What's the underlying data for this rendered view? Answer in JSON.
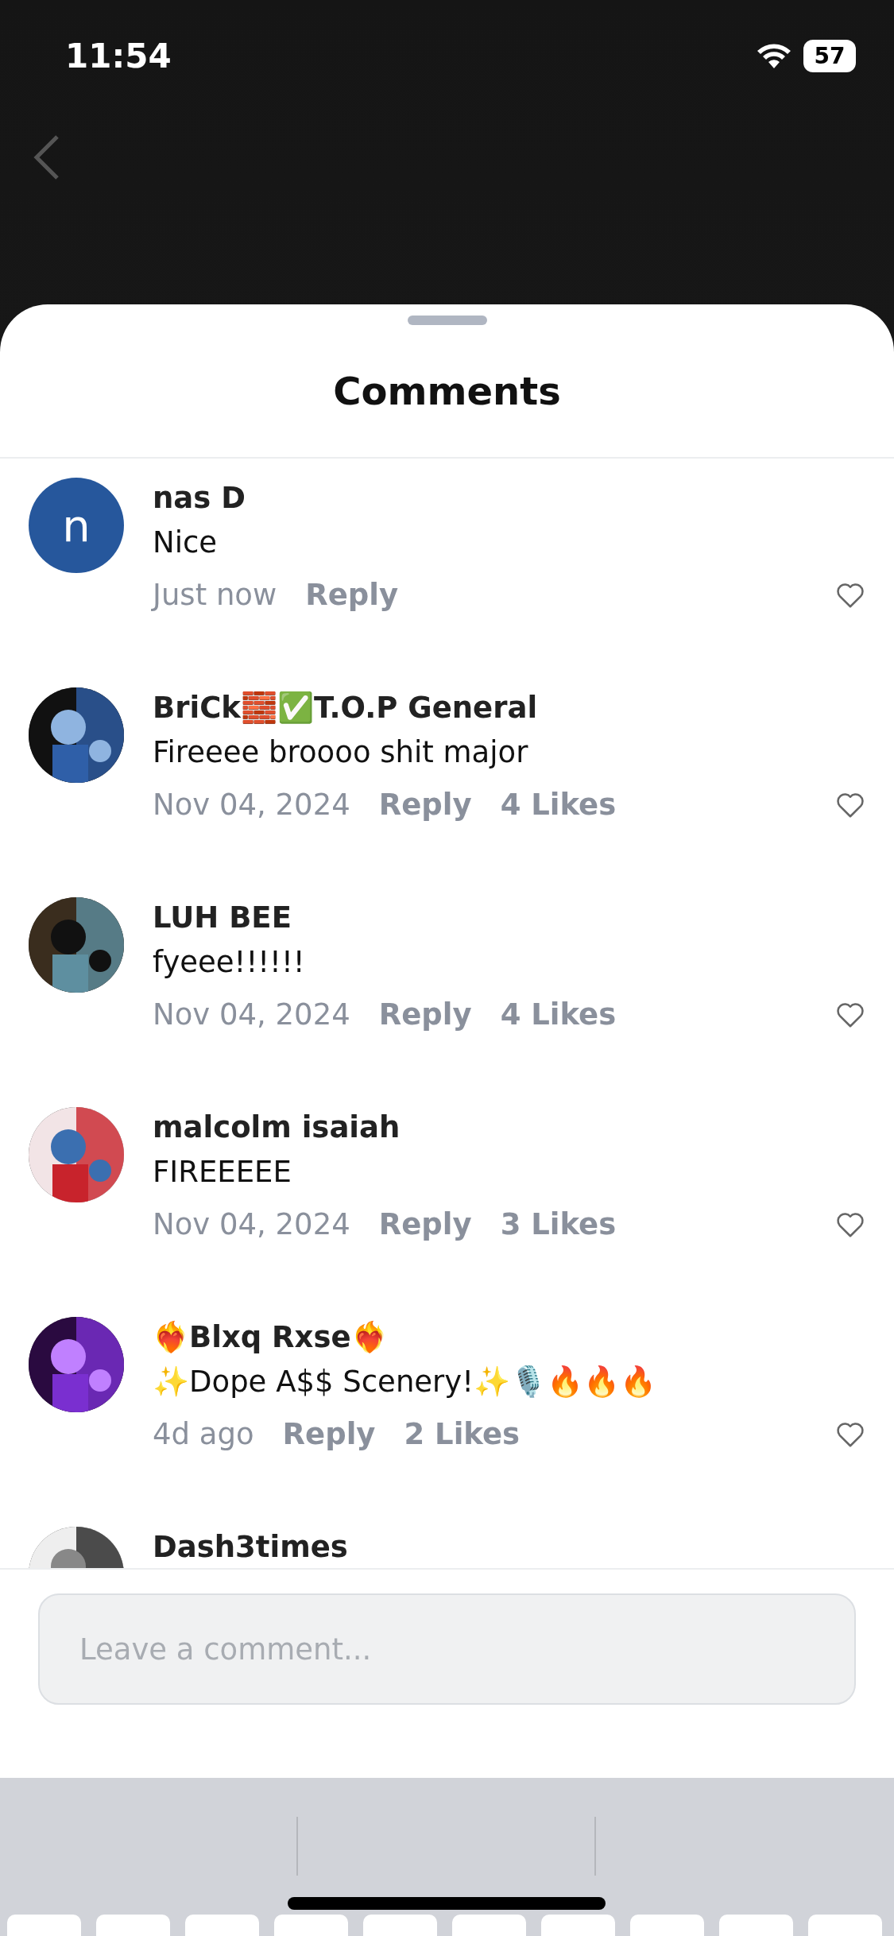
{
  "status_bar": {
    "time": "11:54",
    "battery": "57"
  },
  "sheet": {
    "title": "Comments"
  },
  "comments": [
    {
      "avatar": {
        "kind": "letter",
        "letter": "n",
        "color": "#26579c"
      },
      "name": "nas D",
      "text": "Nice",
      "time": "Just now",
      "reply": "Reply"
    },
    {
      "name": "BriCk🧱✅T.O.P General",
      "text": "Fireeee broooo shit major",
      "time": "Nov 04, 2024",
      "reply": "Reply",
      "likes": "4 Likes"
    },
    {
      "name": "LUH BEE",
      "text": "fyeee!!!!!!",
      "time": "Nov 04, 2024",
      "reply": "Reply",
      "likes": "4 Likes"
    },
    {
      "name": "malcolm isaiah",
      "text": "FIREEEEE",
      "time": "Nov 04, 2024",
      "reply": "Reply",
      "likes": "3 Likes"
    },
    {
      "name": "❤️‍🔥Blxq Rxse❤️‍🔥",
      "text": "✨Dope A$$ Scenery!✨🎙️🔥🔥🔥",
      "time": "4d ago",
      "reply": "Reply",
      "likes": "2 Likes"
    },
    {
      "name": "Dash3times"
    }
  ],
  "composer": {
    "placeholder": "Leave a comment..."
  }
}
